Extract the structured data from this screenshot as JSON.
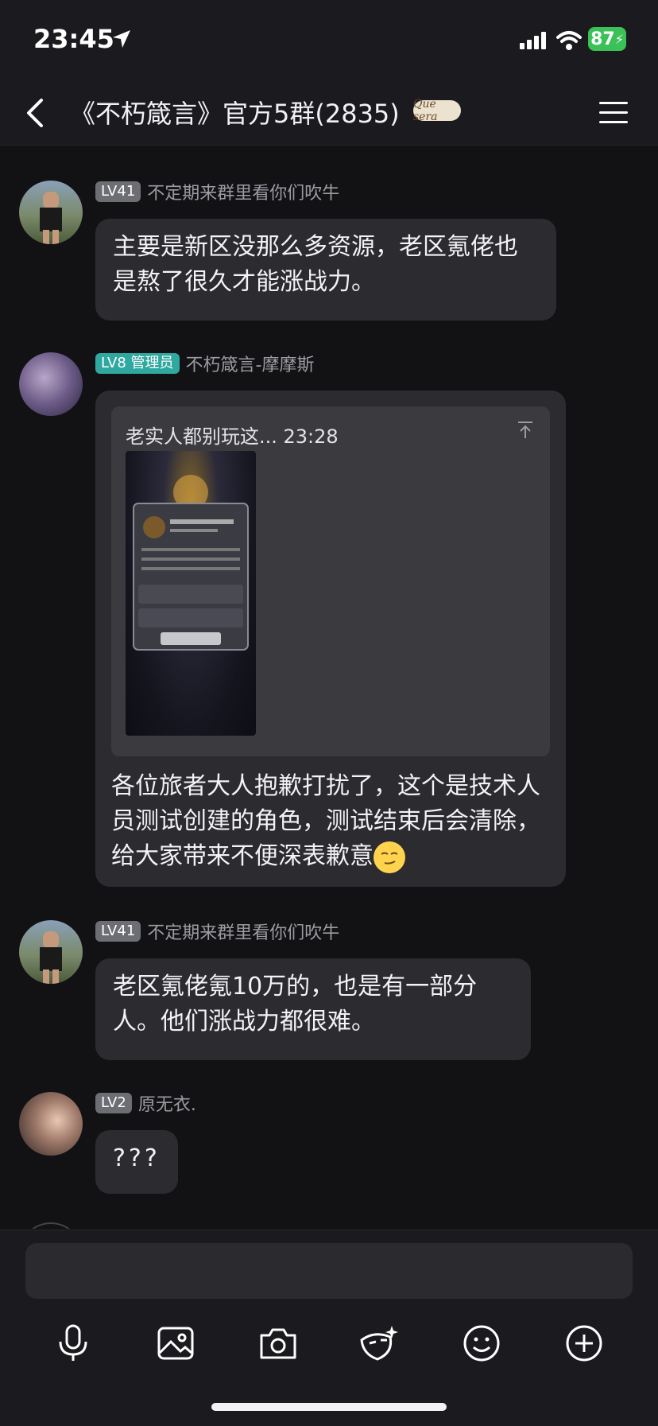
{
  "status_bar": {
    "time": "23:45",
    "battery": "87"
  },
  "header": {
    "title": "《不朽箴言》官方5群(2835)",
    "badge_text": "Que sera"
  },
  "messages": [
    {
      "level": "LV41",
      "nickname": "不定期来群里看你们吹牛",
      "text": "主要是新区没那么多资源，老区氪佬也是熬了很久才能涨战力。"
    },
    {
      "level": "LV8 管理员",
      "nickname": "不朽箴言-摩摩斯",
      "quote_header": "老实人都别玩这... 23:28",
      "text": "各位旅者大人抱歉打扰了，这个是技术人员测试创建的角色，测试结束后会清除，给大家带来不便深表歉意"
    },
    {
      "level": "LV41",
      "nickname": "不定期来群里看你们吹牛",
      "text": "老区氪佬氪10万的，也是有一部分人。他们涨战力都很难。"
    },
    {
      "level": "LV2",
      "nickname": "原无衣.",
      "text": "???"
    }
  ],
  "toolbar": [
    "mic-icon",
    "image-icon",
    "camera-icon",
    "sticker-icon",
    "emoji-icon",
    "plus-icon"
  ],
  "colors": {
    "background": "#121215",
    "bubble": "#2b2b30",
    "admin_badge": "#2fa8a0",
    "level_badge": "#6d6d74",
    "battery": "#3cc159"
  }
}
